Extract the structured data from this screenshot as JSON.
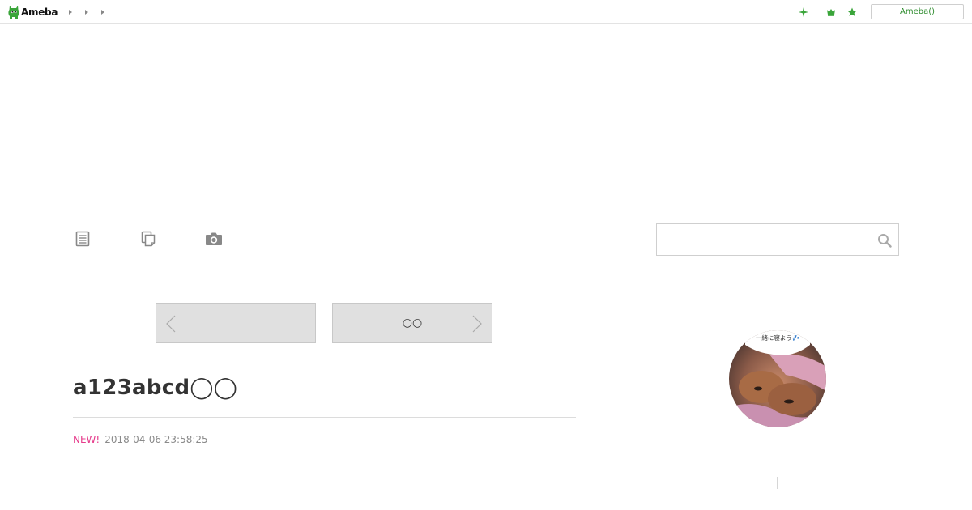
{
  "header": {
    "logo_text": "Ameba",
    "breadcrumbs": [
      "",
      "",
      ""
    ],
    "icons": [
      "sparkle-icon",
      "crown-icon",
      "star-icon"
    ],
    "login_label": "Ameba()",
    "accent_color": "#2d8c2d"
  },
  "nav": {
    "icons": [
      "document-icon",
      "copy-icon",
      "camera-icon"
    ],
    "search": {
      "value": "",
      "placeholder": ""
    }
  },
  "pager": {
    "prev_label": "",
    "next_label": "○○"
  },
  "article": {
    "title": "a123abcd◯◯",
    "new_badge": "NEW!",
    "date": "2018-04-06 23:58:25",
    "new_color": "#e63c8c"
  },
  "sidebar": {
    "profile_caption": "一緒に寝よう💤"
  }
}
